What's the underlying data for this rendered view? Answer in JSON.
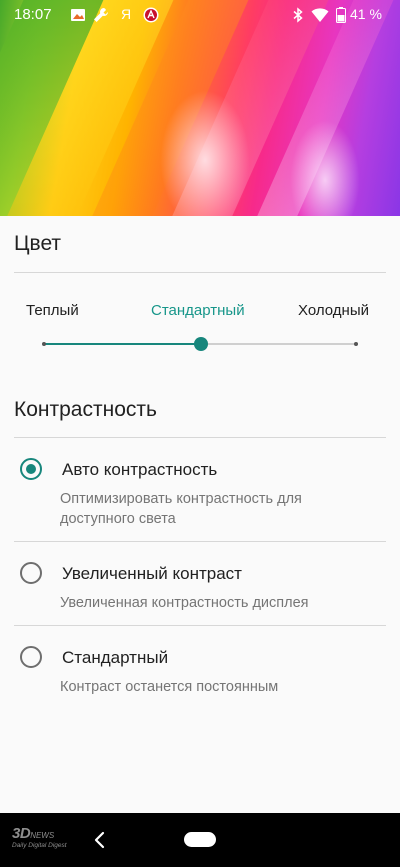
{
  "status_bar": {
    "time": "18:07",
    "letter_icon": "Я",
    "battery_percent": "41 %",
    "icons": [
      "image-icon",
      "wrench-icon",
      "yandex-icon",
      "antutu-icon",
      "bluetooth-icon",
      "wifi-icon",
      "battery-icon"
    ]
  },
  "color_section": {
    "title": "Цвет",
    "options": [
      "Теплый",
      "Стандартный",
      "Холодный"
    ],
    "selected_index": 1,
    "accent_color": "#17867c"
  },
  "contrast_section": {
    "title": "Контрастность",
    "items": [
      {
        "title": "Авто контрастность",
        "subtitle": "Оптимизировать контрастность для доступного света",
        "checked": true
      },
      {
        "title": "Увеличенный контраст",
        "subtitle": "Увеличенная контрастность дисплея",
        "checked": false
      },
      {
        "title": "Стандартный",
        "subtitle": "Контраст останется постоянным",
        "checked": false
      }
    ]
  },
  "nav_bar": {
    "watermark_main": "3D",
    "watermark_news": "NEWS",
    "watermark_sub": "Daily Digital Digest"
  }
}
